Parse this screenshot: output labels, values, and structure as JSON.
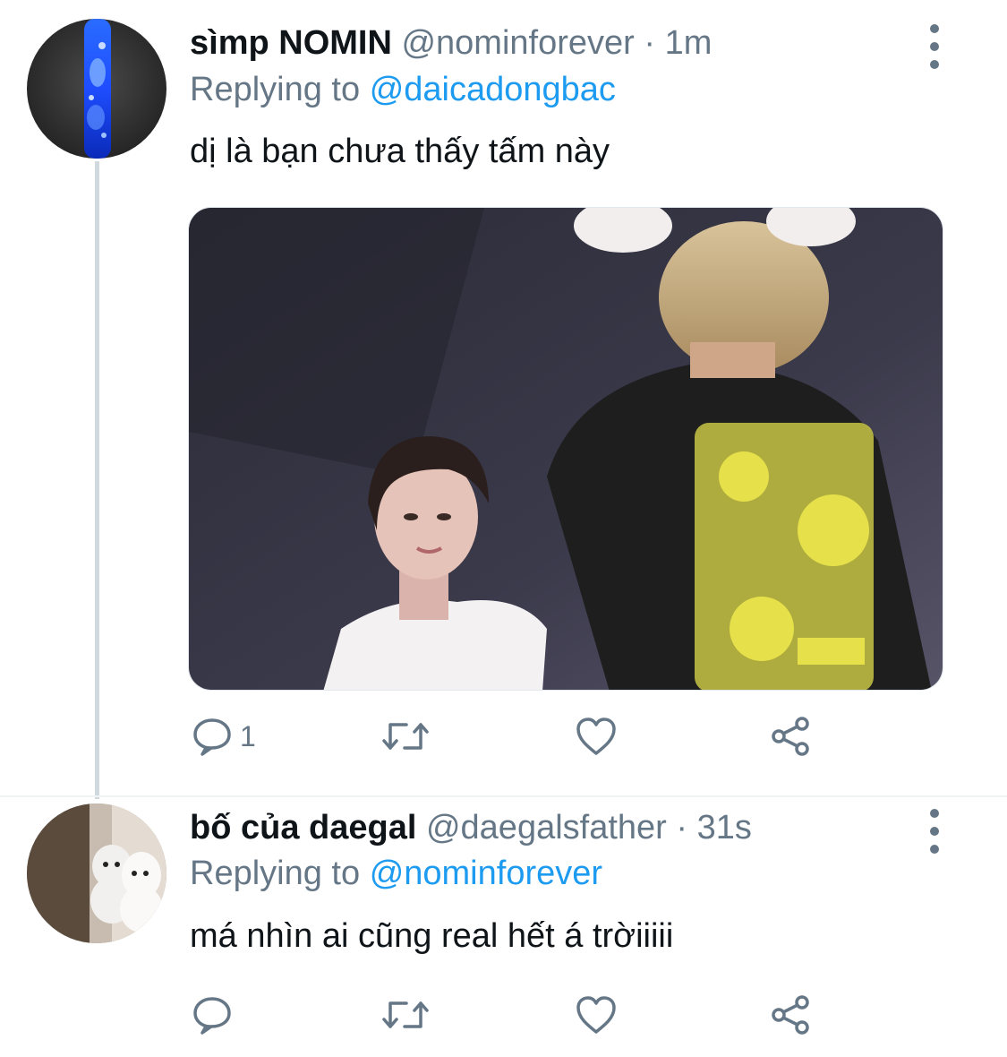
{
  "tweets": [
    {
      "display_name": "sìmp NOMIN",
      "handle": "@nominforever",
      "separator": "·",
      "time": "1m",
      "replying_prefix": "Replying to",
      "replying_to": "@daicadongbac",
      "text": "dị là bạn chưa thấy tấm này",
      "reply_count": "1",
      "has_media": true
    },
    {
      "display_name": "bố của daegal",
      "handle": "@daegalsfather",
      "separator": "·",
      "time": "31s",
      "replying_prefix": "Replying to",
      "replying_to": "@nominforever",
      "text": "má nhìn ai cũng real hết á trờiiiii",
      "reply_count": "",
      "has_media": false
    }
  ],
  "colors": {
    "primary_text": "#0f1419",
    "secondary_text": "#657786",
    "mention": "#1d9bf0",
    "thread_line": "#cfd9de"
  },
  "icons": [
    "more-icon",
    "reply-icon",
    "retweet-icon",
    "like-icon",
    "share-icon"
  ]
}
